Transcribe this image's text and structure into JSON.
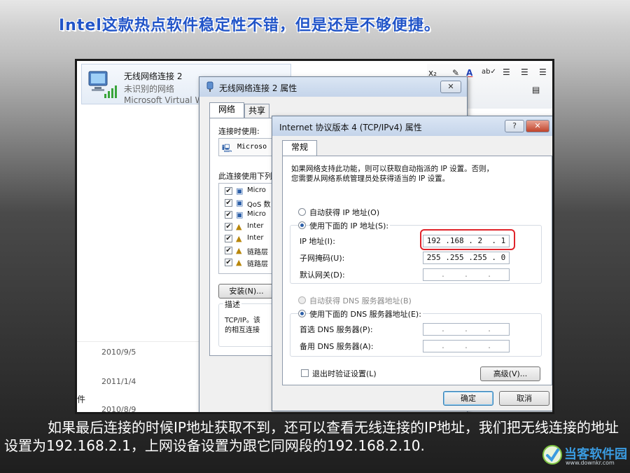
{
  "slide": {
    "heading": "Intel这款热点软件稳定性不错，但是还是不够便捷。",
    "caption": "如果最后连接的时候IP地址获取不到，还可以查看无线连接的IP地址，我们把无线连接的地址设置为192.168.2.1，上网设备设置为跟它同网段的192.168.2.10.",
    "watermark": {
      "name": "当客软件园",
      "url": "www.downkr.com"
    }
  },
  "network_item": {
    "name": "无线网络连接 2",
    "status": "未识别的网络",
    "adapter": "Microsoft Virtual W"
  },
  "background_dates": [
    "2010/9/5",
    "2011/1/4",
    "2010/8/9"
  ],
  "background_fragment": "件",
  "toolbar_icons": [
    "subscript-icon",
    "pen-icon",
    "font-color-icon",
    "spellcheck-icon",
    "align-left-icon",
    "align-center-icon",
    "align-right-icon"
  ],
  "properties_dialog": {
    "title": "无线网络连接 2 属性",
    "close_glyph": "✕",
    "tabs": [
      "网络",
      "共享"
    ],
    "connect_using_label": "连接时使用:",
    "adapter_fragment": "Microso",
    "components_label": "此连接使用下列",
    "components": [
      {
        "icon": "network-client-icon",
        "text": "Micro"
      },
      {
        "icon": "qos-icon",
        "text": "QoS 数"
      },
      {
        "icon": "file-sharing-icon",
        "text": "Micro"
      },
      {
        "icon": "protocol-icon",
        "text": "Inter"
      },
      {
        "icon": "protocol-icon",
        "text": "Inter"
      },
      {
        "icon": "protocol-icon",
        "text": "链路层"
      },
      {
        "icon": "protocol-icon",
        "text": "链路层"
      }
    ],
    "install_button": "安装(N)...",
    "description_label": "描述",
    "description_text": [
      "TCP/IP。该",
      "的相互连接"
    ]
  },
  "ipv4_dialog": {
    "title": "Internet 协议版本 4 (TCP/IPv4) 属性",
    "help_glyph": "?",
    "close_glyph": "✕",
    "tab": "常规",
    "intro": [
      "如果网络支持此功能，则可以获取自动指派的 IP 设置。否则，",
      "您需要从网络系统管理员处获得适当的 IP 设置。"
    ],
    "auto_ip_label": "自动获得 IP 地址(O)",
    "manual_ip_label": "使用下面的 IP 地址(S):",
    "ip_label": "IP 地址(I):",
    "ip_value": "192 .168 . 2  . 1",
    "subnet_label": "子网掩码(U):",
    "subnet_value": "255 .255 .255 . 0",
    "gateway_label": "默认网关(D):",
    "gateway_value": "  .    .    .  ",
    "auto_dns_label": "自动获得 DNS 服务器地址(B)",
    "manual_dns_label": "使用下面的 DNS 服务器地址(E):",
    "preferred_dns_label": "首选 DNS 服务器(P):",
    "preferred_dns_value": "  .    .    .  ",
    "alternate_dns_label": "备用 DNS 服务器(A):",
    "alternate_dns_value": "  .    .    .  ",
    "validate_label": "退出时验证设置(L)",
    "advanced_button": "高级(V)...",
    "ok_button": "确定",
    "cancel_button": "取消"
  },
  "colors": {
    "heading": "#2255c8",
    "highlight": "#e0242b",
    "titlebar": "#c4d4ea"
  }
}
